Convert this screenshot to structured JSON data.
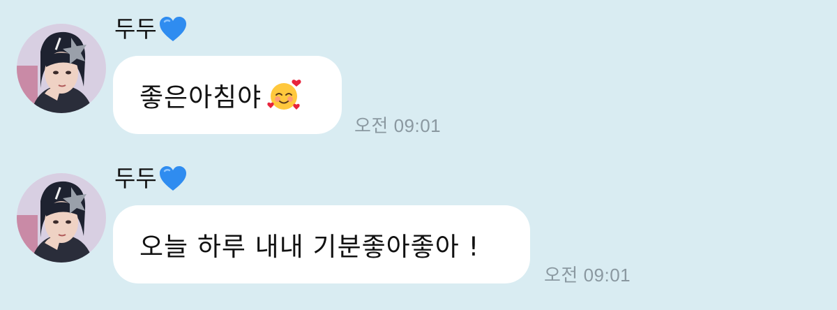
{
  "messages": [
    {
      "sender": "두두",
      "sender_icon": "blue-heart-icon",
      "text": "좋은아침야",
      "emoji": "smiling-face-with-hearts-icon",
      "time": "오전 09:01"
    },
    {
      "sender": "두두",
      "sender_icon": "blue-heart-icon",
      "text": "오늘 하루 내내 기분좋아좋아 !",
      "time": "오전 09:01"
    }
  ],
  "colors": {
    "background": "#d9ecf2",
    "bubble": "#ffffff",
    "time": "#8a98a0",
    "heart": "#2f8cf0"
  }
}
